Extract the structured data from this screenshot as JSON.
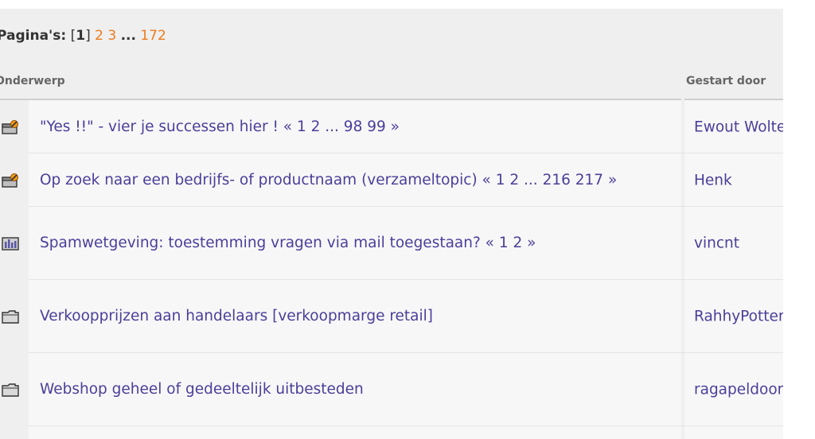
{
  "pagination": {
    "label": "Pagina's:",
    "open_bracket": "[",
    "current": "1",
    "close_bracket": "]",
    "pages": [
      "2",
      "3"
    ],
    "ellipsis": "...",
    "last": "172"
  },
  "columns": {
    "subject": "Onderwerp",
    "started_by": "Gestart door"
  },
  "topics": [
    {
      "icon": "hot-topic-icon",
      "title": "\"Yes !!\" - vier je successen hier ! « 1 2 ... 98 99 »",
      "starter": "Ewout Wolters"
    },
    {
      "icon": "hot-topic-icon",
      "title": "Op zoek naar een bedrijfs- of productnaam (verzameltopic) « 1 2 ... 216 217 »",
      "starter": "Henk"
    },
    {
      "icon": "poll-icon",
      "title": "Spamwetgeving: toestemming vragen via mail toegestaan? « 1 2 »",
      "starter": "vincnt"
    },
    {
      "icon": "folder-icon",
      "title": "Verkoopprijzen aan handelaars [verkoopmarge retail]",
      "starter": "RahhyPotter"
    },
    {
      "icon": "folder-icon",
      "title": "Webshop geheel of gedeeltelijk uitbesteden",
      "starter": "ragapeldoorn"
    }
  ]
}
